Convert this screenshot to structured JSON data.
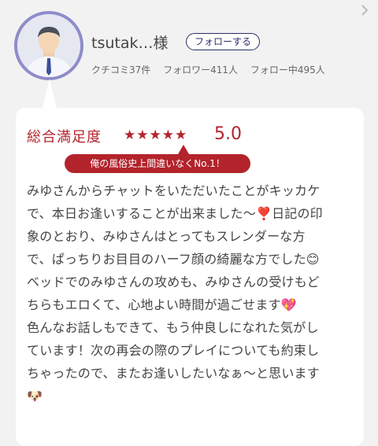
{
  "profile": {
    "username": "tsutak…様",
    "follow_label": "フォローする",
    "stats": {
      "reviews": "クチコミ37件",
      "followers": "フォロワー411人",
      "following": "フォロー中495人"
    }
  },
  "rating": {
    "label": "総合満足度",
    "stars": "★★★★★",
    "score": "5.0",
    "tag": "俺の風俗史上間違いなくNo.1！"
  },
  "review": {
    "lines": [
      "みゆさんからチャットをいただいたことがキッカケ",
      "で、本日お逢いすることが出来ました〜❣️日記の印",
      "象のとおり、みゆさんはとってもスレンダーな方",
      "で、ぱっちりお目目のハーフ顔の綺麗な方でした😊",
      "ベッドでのみゆさんの攻めも、みゆさんの受けもど",
      "ちらもエロくて、心地よい時間が過ごせます💖",
      "色んなお話しもできて、もう仲良しになれた気がし",
      "ています！次の再会の際のプレイについても約束し",
      "ちゃったので、またお逢いしたいなぁ〜と思います",
      "🐶"
    ]
  },
  "colors": {
    "accent_red": "#b3232b",
    "follow_navy": "#2b2f6b",
    "avatar_ring": "#8e8cc8"
  }
}
